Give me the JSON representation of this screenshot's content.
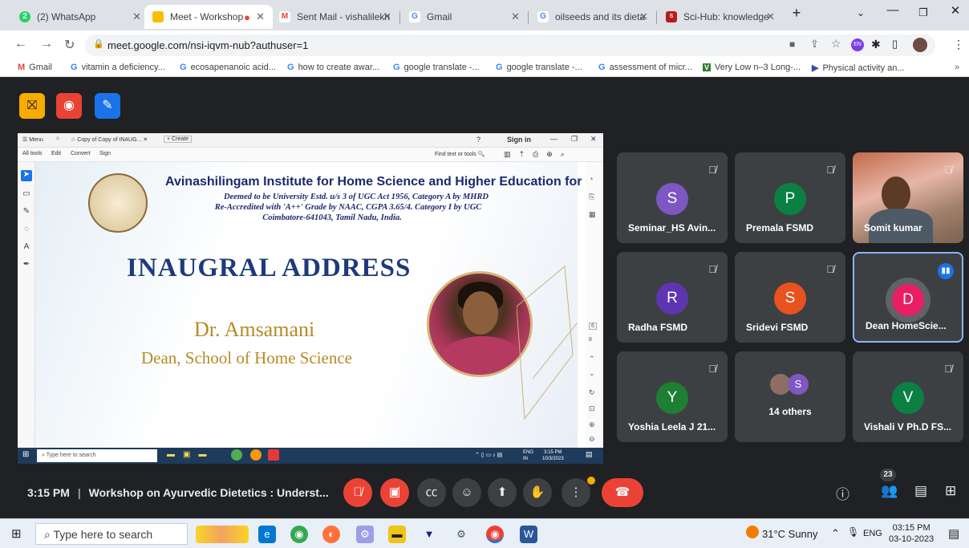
{
  "browser": {
    "tabs": [
      {
        "label": "(2) WhatsApp",
        "fav_color": "#25d366",
        "fav_text": "2"
      },
      {
        "label": "Meet - Workshop",
        "fav_color": "#fbbc04",
        "fav_text": "",
        "active": true
      },
      {
        "label": "Sent Mail - vishalilekh",
        "fav_color": "#ea4335",
        "fav_text": "M"
      },
      {
        "label": "Gmail",
        "fav_color": "#4285f4",
        "fav_text": "G"
      },
      {
        "label": "oilseeds and its dieta",
        "fav_color": "#4285f4",
        "fav_text": "G"
      },
      {
        "label": "Sci-Hub: knowledge",
        "fav_color": "#b71c1c",
        "fav_text": "S"
      }
    ],
    "url": "meet.google.com/nsi-iqvm-nub?authuser=1",
    "bookmarks": [
      "Gmail",
      "vitamin a deficiency...",
      "ecosapenanoic acid...",
      "how to create awar...",
      "google translate -...",
      "google translate -...",
      "assessment of micr...",
      "Very Low n–3 Long-...",
      "Physical activity an..."
    ],
    "profile_badge": "EN"
  },
  "pdf": {
    "menu_label": "Menu",
    "tab_label": "Copy of Copy of INAUG...",
    "create_label": "+ Create",
    "sign_in": "Sign in",
    "menu_items": [
      "All tools",
      "Edit",
      "Convert",
      "Sign"
    ],
    "find_text": "Find text or tools",
    "page_num": "6",
    "page_total": "8"
  },
  "slide": {
    "institute": "Avinashilingam Institute for Home Science and Higher Education for Women",
    "line1": "Deemed to be University Estd. u/s 3 of UGC Act 1956, Category A by MHRD",
    "line2": "Re-Accredited with 'A++' Grade by NAAC, CGPA 3.65/4. Category I by UGC",
    "line3": "Coimbatore-641043, Tamil Nadu, India.",
    "heading": "INAUGRAL ADDRESS",
    "speaker": "Dr. Amsamani",
    "role": "Dean, School of Home Science"
  },
  "shared_taskbar": {
    "search": "Type here to search",
    "time": "3:15 PM",
    "date": "10/3/2023",
    "lang": "ENG",
    "region": "IN"
  },
  "participants": [
    {
      "name": "Seminar_HS Avin...",
      "initial": "S",
      "color": "#7e57c2",
      "muted": true
    },
    {
      "name": "Premala FSMD",
      "initial": "P",
      "color": "#0b8043",
      "muted": true
    },
    {
      "name": "Somit kumar",
      "initial": "",
      "color": "",
      "muted": true,
      "video": true
    },
    {
      "name": "Radha FSMD",
      "initial": "R",
      "color": "#5e35b1",
      "muted": true
    },
    {
      "name": "Sridevi FSMD",
      "initial": "S",
      "color": "#e8521f",
      "muted": true
    },
    {
      "name": "Dean HomeScie...",
      "initial": "D",
      "color": "#e91e63",
      "muted": false,
      "speaking": true
    },
    {
      "name": "Yoshia Leela J 21...",
      "initial": "Y",
      "color": "#1e7e34",
      "muted": true
    },
    {
      "name": "14 others",
      "initial": "S",
      "color": "#7e57c2",
      "muted": false,
      "others": true
    },
    {
      "name": "Vishali V Ph.D FS...",
      "initial": "V",
      "color": "#0b8043",
      "muted": true
    }
  ],
  "meeting": {
    "time": "3:15 PM",
    "title": "Workshop on Ayurvedic Dietetics : Underst...",
    "participant_count": "23"
  },
  "taskbar": {
    "search": "Type here to search",
    "weather": "31°C  Sunny",
    "lang": "ENG",
    "time": "03:15 PM",
    "date": "03-10-2023"
  }
}
